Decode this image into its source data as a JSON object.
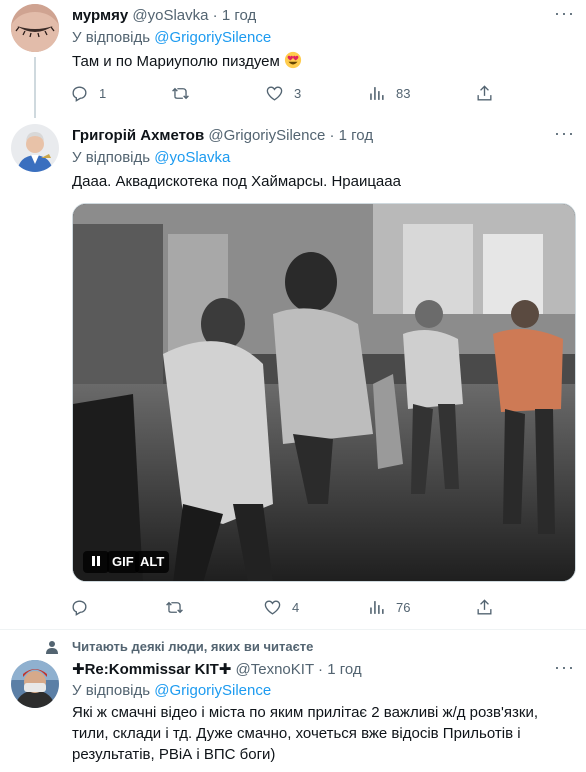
{
  "tweets": [
    {
      "name": "мурмяу",
      "handle": "@yoSlavka",
      "sep": "·",
      "time": "1 год",
      "reply_prefix": "У відповідь",
      "reply_handle": "@GrigoriySilence",
      "text": "Там и по Мариуполю пиздуем",
      "emoji": "heart-eyes-emoji",
      "stats": {
        "reply": "1",
        "retweet": "",
        "like": "3",
        "views": "83"
      }
    },
    {
      "name": "Григорій Ахметов",
      "handle": "@GrigoriySilence",
      "sep": "·",
      "time": "1 год",
      "reply_prefix": "У відповідь",
      "reply_handle": "@yoSlavka",
      "text": "Дааа. Аквадискотека под Хаймарсы. Нраицааа",
      "media": {
        "pause_icon": "pause-icon",
        "gif_label": "GIF",
        "alt_label": "ALT"
      },
      "stats": {
        "reply": "",
        "retweet": "",
        "like": "4",
        "views": "76"
      }
    },
    {
      "social_context": "Читають деякі люди, яких ви читаєте",
      "name": "✚Re:Kommissar KIT✚",
      "handle": "@TexnoKIT",
      "sep": "·",
      "time": "1 год",
      "reply_prefix": "У відповідь",
      "reply_handle": "@GrigoriySilence",
      "text_lines": [
        "Які ж смачні відео і міста по яким прилітає 2 важливі ж/д розв'язки,",
        "тили, склади і тд. Дуже смачно, хочеться вже відосів Прильотів і",
        "результатів, РВіА і ВПС боги)"
      ]
    }
  ],
  "colors": {
    "accent": "#1d9bf0",
    "muted": "#536471",
    "text": "#0f1419"
  }
}
